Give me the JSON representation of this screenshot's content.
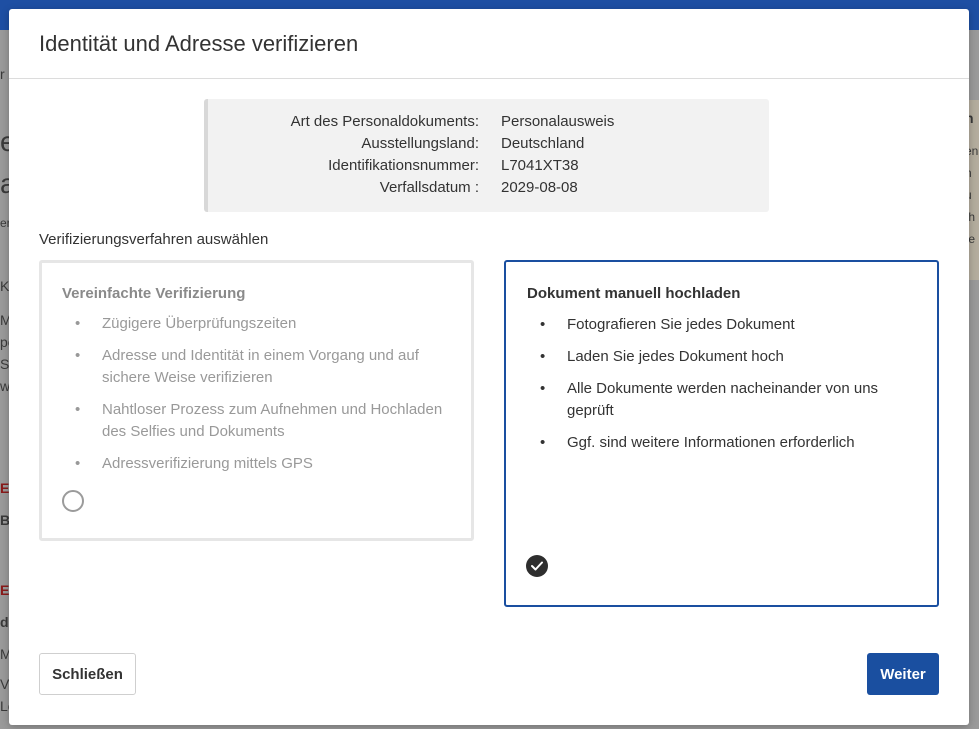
{
  "dialog": {
    "title": "Identität und Adresse verifizieren"
  },
  "document_info": {
    "rows": [
      {
        "label": "Art des Personaldokuments:",
        "value": "Personalausweis"
      },
      {
        "label": "Ausstellungsland:",
        "value": "Deutschland"
      },
      {
        "label": "Identifikationsnummer:",
        "value": "L7041XT38"
      },
      {
        "label": "Verfallsdatum :",
        "value": "2029-08-08"
      }
    ]
  },
  "method_section": {
    "label": "Verifizierungsverfahren auswählen"
  },
  "options": [
    {
      "title": "Vereinfachte Verifizierung",
      "selected": false,
      "bullets": [
        "Zügigere Überprüfungszeiten",
        "Adresse und Identität in einem Vorgang und auf sichere Weise verifizieren",
        "Nahtloser Prozess zum Aufnehmen und Hochladen des Selfies und Dokuments",
        "Adressverifizierung mittels GPS"
      ]
    },
    {
      "title": "Dokument manuell hochladen",
      "selected": true,
      "bullets": [
        "Fotografieren Sie jedes Dokument",
        "Laden Sie jedes Dokument hoch",
        "Alle Dokumente werden nacheinander von uns geprüft",
        "Ggf. sind weitere Informationen erforderlich"
      ]
    }
  ],
  "buttons": {
    "close": "Schließen",
    "next": "Weiter"
  },
  "background": {
    "fragments": [
      "r",
      "e",
      "a",
      "er",
      "K",
      "M",
      "pe",
      "Se",
      "w",
      "E",
      "B",
      "E",
      "d",
      "M",
      "V",
      "Le",
      "n",
      "en",
      "n",
      "u",
      "th",
      "fe"
    ]
  },
  "colors": {
    "accent": "#1a4fa0",
    "selected_border": "#1a4fa0",
    "muted_text": "#999999"
  }
}
